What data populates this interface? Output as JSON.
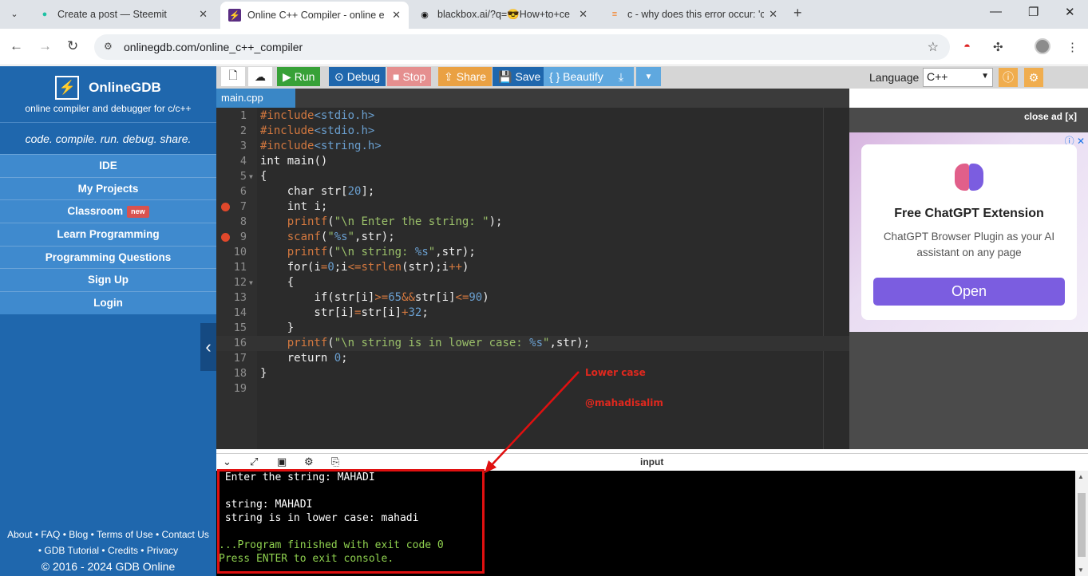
{
  "browser": {
    "tabs": [
      {
        "title": "Create a post — Steemit",
        "favicon": "steemit-icon"
      },
      {
        "title": "Online C++ Compiler - online e",
        "favicon": "onlinegdb-icon"
      },
      {
        "title": "blackbox.ai/?q=😎How+to+ce",
        "favicon": "blackbox-icon"
      },
      {
        "title": "c - why does this error occur: 'c",
        "favicon": "stackoverflow-icon"
      }
    ],
    "new_tab": "+",
    "url": "onlinegdb.com/online_c++_compiler"
  },
  "sidebar": {
    "logo_glyph": "⚡",
    "brand": "OnlineGDB",
    "subtitle": "online compiler and debugger for c/c++",
    "tagline": "code. compile. run. debug. share.",
    "nav": [
      {
        "label": "IDE"
      },
      {
        "label": "My Projects"
      },
      {
        "label": "Classroom",
        "badge": "new"
      },
      {
        "label": "Learn Programming"
      },
      {
        "label": "Programming Questions"
      },
      {
        "label": "Sign Up"
      },
      {
        "label": "Login"
      }
    ],
    "footer": {
      "line1": [
        "About",
        "FAQ",
        "Blog",
        "Terms of Use",
        "Contact Us"
      ],
      "line2": [
        "GDB Tutorial",
        "Credits",
        "Privacy"
      ],
      "copyright": "© 2016 - 2024 GDB Online"
    }
  },
  "toolbar": {
    "run": "Run",
    "debug": "Debug",
    "stop": "Stop",
    "share": "Share",
    "save": "Save",
    "beautify": "{ } Beautify",
    "language_label": "Language",
    "language_value": "C++",
    "colors": {
      "run": "#37a137",
      "debug": "#1f67ad",
      "stop": "#e58f8f",
      "share": "#eaa143",
      "save": "#1f67ad",
      "beautify": "#5fa8df",
      "info": "#f0ad4e"
    }
  },
  "editor": {
    "file_tab": "main.cpp",
    "breakpoint_lines": [
      7,
      9
    ],
    "fold_lines": [
      5,
      12
    ],
    "lines": [
      "#include<stdio.h>",
      "#include<stdio.h>",
      "#include<string.h>",
      "int main()",
      "{",
      "    char str[20];",
      "    int i;",
      "    printf(\"\\n Enter the string: \");",
      "    scanf(\"%s\",str);",
      "    printf(\"\\n string: %s\",str);",
      "    for(i=0;i<=strlen(str);i++)",
      "    {",
      "        if(str[i]>=65&&str[i]<=90)",
      "        str[i]=str[i]+32;",
      "    }",
      "    printf(\"\\n string is in lower case: %s\",str);",
      "    return 0;",
      "}",
      ""
    ]
  },
  "ad": {
    "close": "close ad [x]",
    "title": "Free ChatGPT Extension",
    "description": "ChatGPT Browser Plugin as your AI assistant on any page",
    "button": "Open"
  },
  "output": {
    "input_label": "input",
    "console_lines": [
      {
        "text": " Enter the string: MAHADI",
        "style": "white"
      },
      {
        "text": "",
        "style": "white"
      },
      {
        "text": " string: MAHADI",
        "style": "white"
      },
      {
        "text": " string is in lower case: mahadi",
        "style": "white"
      },
      {
        "text": "",
        "style": "white"
      },
      {
        "text": "...Program finished with exit code 0",
        "style": "green"
      },
      {
        "text": "Press ENTER to exit console.",
        "style": "green"
      }
    ]
  },
  "annotations": {
    "label1": "Lower case",
    "label2": "@mahadisalim",
    "color": "#e0281e"
  }
}
